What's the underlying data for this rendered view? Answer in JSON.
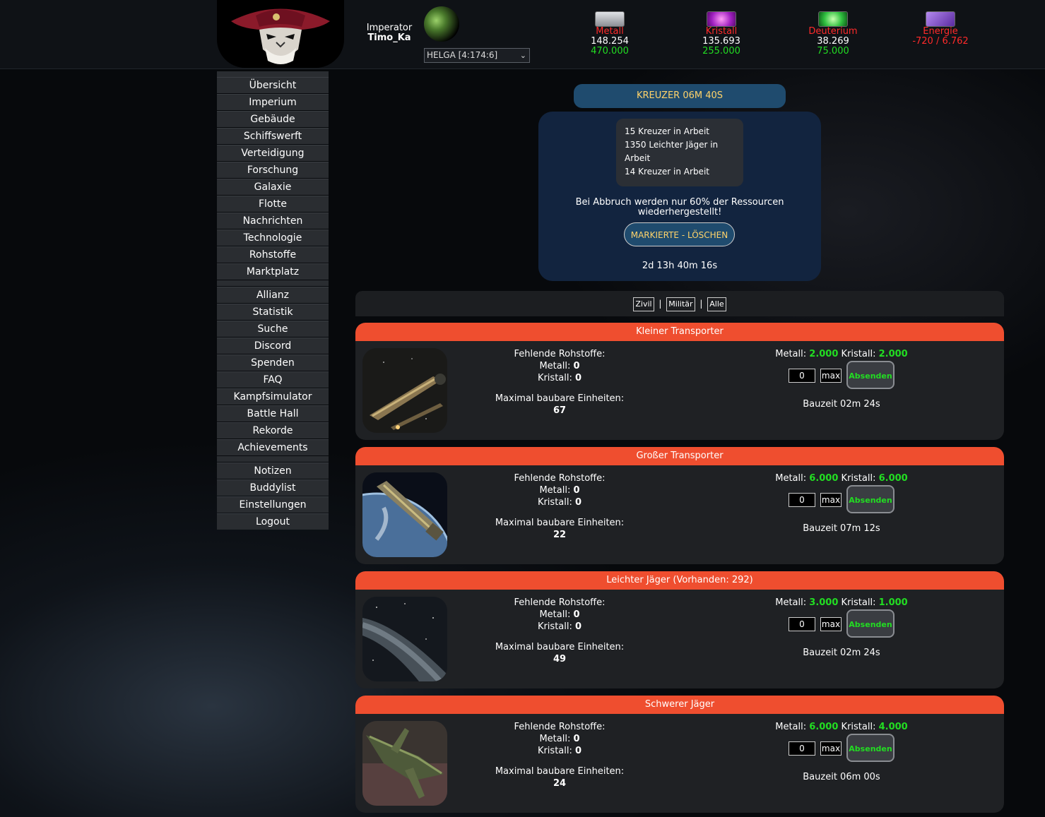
{
  "header": {
    "rank": "Imperator",
    "player": "Timo_Ka",
    "planet_select": "HELGA [4:174:6]",
    "resources": [
      {
        "name": "Metall",
        "current": "148.254",
        "capacity": "470.000",
        "icon_color": "#b9bcc2"
      },
      {
        "name": "Kristall",
        "current": "135.693",
        "capacity": "255.000",
        "icon_color": "#c03fd1"
      },
      {
        "name": "Deuterium",
        "current": "38.269",
        "capacity": "75.000",
        "icon_color": "#3fd14a"
      },
      {
        "name": "Energie",
        "current": "-720 / 6.762",
        "capacity": "",
        "icon_color": "#8f5cd6"
      }
    ]
  },
  "menu": {
    "group1": [
      "Übersicht",
      "Imperium",
      "Gebäude",
      "Schiffswerft",
      "Verteidigung",
      "Forschung",
      "Galaxie",
      "Flotte",
      "Nachrichten",
      "Technologie",
      "Rohstoffe",
      "Marktplatz"
    ],
    "group2": [
      "Allianz",
      "Statistik",
      "Suche",
      "Discord",
      "Spenden",
      "FAQ",
      "Kampfsimulator",
      "Battle Hall",
      "Rekorde",
      "Achievements"
    ],
    "group3": [
      "Notizen",
      "Buddylist",
      "Einstellungen",
      "Logout"
    ]
  },
  "queue": {
    "current": "KREUZER 06M 40S",
    "items": [
      "15 Kreuzer in Arbeit",
      "1350 Leichter Jäger in Arbeit",
      "14 Kreuzer in Arbeit"
    ],
    "warning_line1": "Bei Abbruch werden nur 60% der Ressourcen",
    "warning_line2": "wiederhergestellt!",
    "delete_button": "MARKIERTE - LÖSCHEN",
    "total_time": "2d 13h 40m 16s"
  },
  "filters": {
    "civil": "Zivil",
    "military": "Militär",
    "all": "Alle",
    "sep": "|"
  },
  "labels": {
    "missing": "Fehlende Rohstoffe:",
    "metal": "Metall:",
    "crystal": "Kristall:",
    "max_units": "Maximal baubare Einheiten:",
    "max_button": "max",
    "send_button": "Absenden"
  },
  "ships": [
    {
      "title": "Kleiner Transporter",
      "missing_metal": "0",
      "missing_crystal": "0",
      "max_units": "67",
      "cost_metal": "2.000",
      "cost_crystal": "2.000",
      "qty": "0",
      "build_time": "Bauzeit 02m 24s"
    },
    {
      "title": "Großer Transporter",
      "missing_metal": "0",
      "missing_crystal": "0",
      "max_units": "22",
      "cost_metal": "6.000",
      "cost_crystal": "6.000",
      "qty": "0",
      "build_time": "Bauzeit 07m 12s"
    },
    {
      "title": "Leichter Jäger (Vorhanden: 292)",
      "missing_metal": "0",
      "missing_crystal": "0",
      "max_units": "49",
      "cost_metal": "3.000",
      "cost_crystal": "1.000",
      "qty": "0",
      "build_time": "Bauzeit 02m 24s"
    },
    {
      "title": "Schwerer Jäger",
      "missing_metal": "0",
      "missing_crystal": "0",
      "max_units": "24",
      "cost_metal": "6.000",
      "cost_crystal": "4.000",
      "qty": "0",
      "build_time": "Bauzeit 06m 00s"
    }
  ]
}
